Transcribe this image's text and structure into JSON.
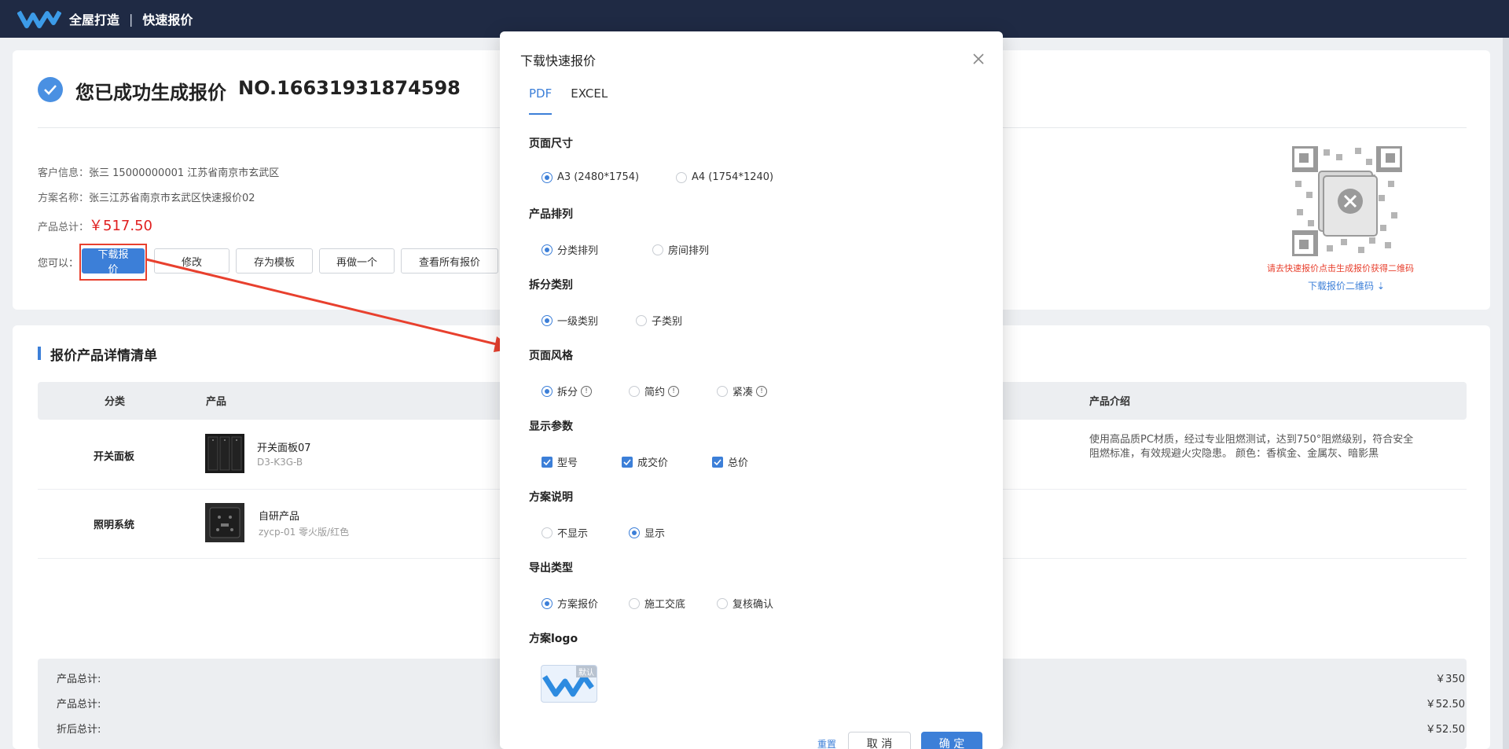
{
  "header": {
    "brand": "全屋打造",
    "separator": "|",
    "page": "快速报价"
  },
  "success": {
    "title": "您已成功生成报价",
    "quote_no": "NO.16631931874598"
  },
  "info": {
    "customer_label": "客户信息：",
    "customer_value": "张三  15000000001  江苏省南京市玄武区",
    "plan_label": "方案名称：",
    "plan_value": "张三江苏省南京市玄武区快速报价02",
    "total_label": "产品总计：",
    "total_value": "￥517.50"
  },
  "actions": {
    "label": "您可以：",
    "buttons": [
      "下载报价",
      "修改",
      "存为模板",
      "再做一个",
      "查看所有报价"
    ]
  },
  "qr": {
    "hint": "请去快速报价点击生成报价获得二维码",
    "download": "下载报价二维码 ⇣"
  },
  "list": {
    "title": "报价产品详情清单",
    "headers": {
      "category": "分类",
      "product": "产品",
      "intro": "产品介绍"
    },
    "rows": [
      {
        "category": "开关面板",
        "name": "开关面板07",
        "code": "D3-K3G-B",
        "intro": "使用高品质PC材质，经过专业阻燃测试，达到750°阻燃级别，符合安全阻燃标准，有效规避火灾隐患。 颜色：香槟金、金属灰、暗影黑"
      },
      {
        "category": "照明系统",
        "name": "自研产品",
        "code": "zycp-01 零火版/红色",
        "intro": ""
      }
    ]
  },
  "summary": {
    "rows": [
      {
        "label": "产品总计:",
        "value": "￥350"
      },
      {
        "label": "产品总计:",
        "value": "￥52.50"
      },
      {
        "label": "折后总计:",
        "value": "￥52.50"
      }
    ]
  },
  "modal": {
    "title": "下载快速报价",
    "tabs": [
      "PDF",
      "EXCEL"
    ],
    "sections": {
      "page_size": {
        "title": "页面尺寸",
        "options": [
          "A3 (2480*1754)",
          "A4 (1754*1240)"
        ]
      },
      "arrange": {
        "title": "产品排列",
        "options": [
          "分类排列",
          "房间排列"
        ]
      },
      "split": {
        "title": "拆分类别",
        "options": [
          "一级类别",
          "子类别"
        ]
      },
      "style": {
        "title": "页面风格",
        "options": [
          "拆分",
          "简约",
          "紧凑"
        ]
      },
      "params": {
        "title": "显示参数",
        "options": [
          "型号",
          "成交价",
          "总价"
        ]
      },
      "desc": {
        "title": "方案说明",
        "options": [
          "不显示",
          "显示"
        ]
      },
      "export": {
        "title": "导出类型",
        "options": [
          "方案报价",
          "施工交底",
          "复核确认"
        ]
      },
      "logo": {
        "title": "方案logo",
        "badge": "默认"
      }
    },
    "footer": {
      "reset": "重置",
      "cancel": "取 消",
      "ok": "确 定"
    }
  },
  "colors": {
    "primary": "#3c7fd8",
    "header_bg": "#1f2a44",
    "danger": "#e02020",
    "annotation": "#e8402e"
  }
}
